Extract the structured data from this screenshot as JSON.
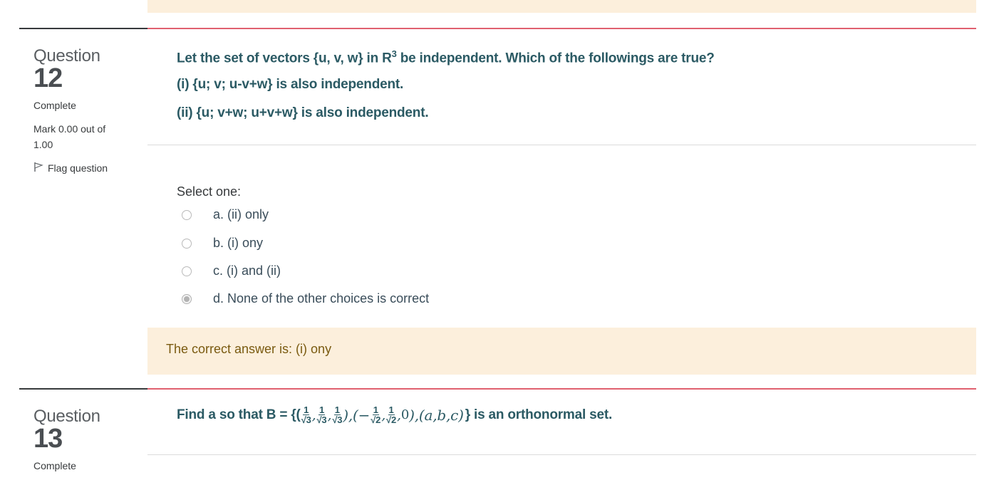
{
  "colors": {
    "feedback_bg": "#fcefdc",
    "accent_border": "#e0606f",
    "question_text": "#2b5a64",
    "answer_text": "#7a5a10"
  },
  "q12": {
    "label": "Question",
    "number": "12",
    "state": "Complete",
    "grade": "Mark 0.00 out of 1.00",
    "flag_label": "Flag question",
    "text_lines": [
      "Let the set of vectors {u, v, w} in R",
      "3",
      " be independent. Which of the followings are true?",
      "(i) {u; v; u-v+w} is also independent.",
      "(ii) {u; v+w; u+v+w} is also independent."
    ],
    "prompt": "Select one:",
    "options": [
      {
        "label": "a. (ii) only",
        "checked": false
      },
      {
        "label": "b. (i) ony",
        "checked": false
      },
      {
        "label": "c. (i) and (ii)",
        "checked": false
      },
      {
        "label": "d. None of the other choices is correct",
        "checked": true
      }
    ],
    "right_answer": "The correct answer is: (i) ony"
  },
  "q13": {
    "label": "Question",
    "number": "13",
    "state": "Complete",
    "text_prefix": "Find a so that B = {(",
    "math": {
      "one": "1",
      "root3": "√3",
      "root2": "√2",
      "comma": ",",
      "close_open": "),(",
      "minus": "−",
      "zero": "0",
      "abc": "(a,b,c)"
    },
    "text_suffix": "} is an orthonormal set."
  }
}
